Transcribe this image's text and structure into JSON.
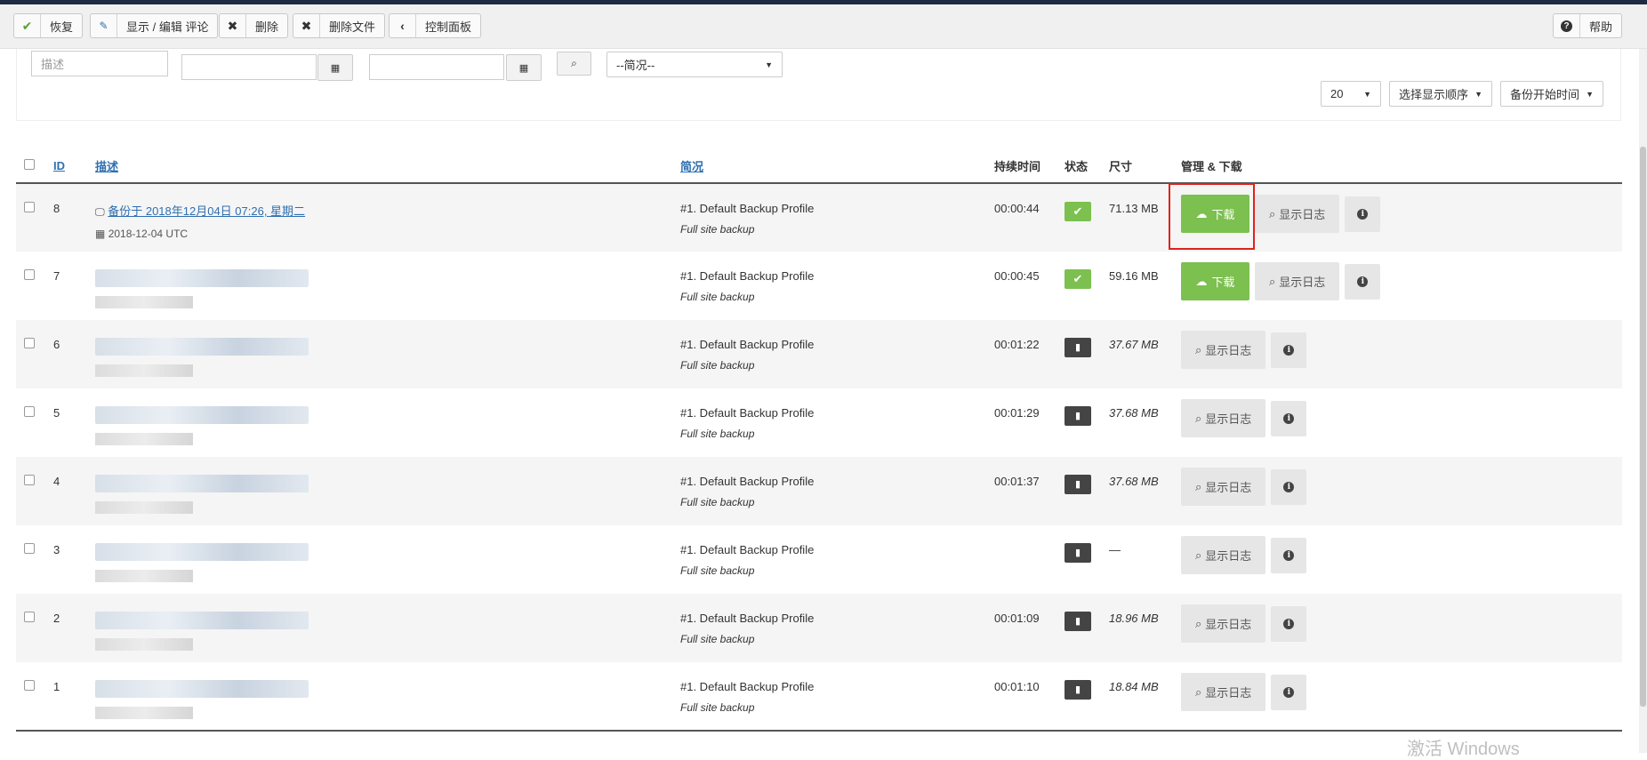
{
  "toolbar": {
    "restore": "恢复",
    "edit_comment": "显示 / 编辑 评论",
    "delete": "删除",
    "delete_files": "删除文件",
    "control_panel": "控制面板",
    "help": "帮助"
  },
  "filters": {
    "description_placeholder": "描述",
    "date_from": "",
    "date_to": "",
    "profile_select": "--简况--",
    "page_size": "20",
    "order_by": "选择显示顺序",
    "order_field": "备份开始时间"
  },
  "table": {
    "headers": {
      "id": "ID",
      "description": "描述",
      "profile": "简况",
      "duration": "持续时间",
      "status": "状态",
      "size": "尺寸",
      "manage": "管理 & 下载"
    },
    "profile_name": "#1. Default Backup Profile",
    "profile_sub": "Full site backup",
    "download_label": "下载",
    "log_label": "显示日志",
    "rows": [
      {
        "id": "8",
        "desc": "备份于 2018年12月04日 07:26, 星期二",
        "date": "2018-12-04 UTC",
        "duration": "00:00:44",
        "status": "ok",
        "size": "71.13 MB"
      },
      {
        "id": "7",
        "desc": "",
        "date": "",
        "duration": "00:00:45",
        "status": "ok",
        "size": "59.16 MB"
      },
      {
        "id": "6",
        "desc": "",
        "date": "",
        "duration": "00:01:22",
        "status": "deleted",
        "size": "37.67 MB"
      },
      {
        "id": "5",
        "desc": "",
        "date": "",
        "duration": "00:01:29",
        "status": "deleted",
        "size": "37.68 MB"
      },
      {
        "id": "4",
        "desc": "",
        "date": "",
        "duration": "00:01:37",
        "status": "deleted",
        "size": "37.68 MB"
      },
      {
        "id": "3",
        "desc": "",
        "date": "",
        "duration": "",
        "status": "deleted",
        "size": "—"
      },
      {
        "id": "2",
        "desc": "",
        "date": "",
        "duration": "00:01:09",
        "status": "deleted",
        "size": "18.96 MB"
      },
      {
        "id": "1",
        "desc": "",
        "date": "",
        "duration": "00:01:10",
        "status": "deleted",
        "size": "18.84 MB"
      }
    ]
  },
  "watermark": "激活 Windows",
  "colors": {
    "success": "#7cc04f",
    "highlight": "#e0221b",
    "link": "#2f6fb0"
  }
}
